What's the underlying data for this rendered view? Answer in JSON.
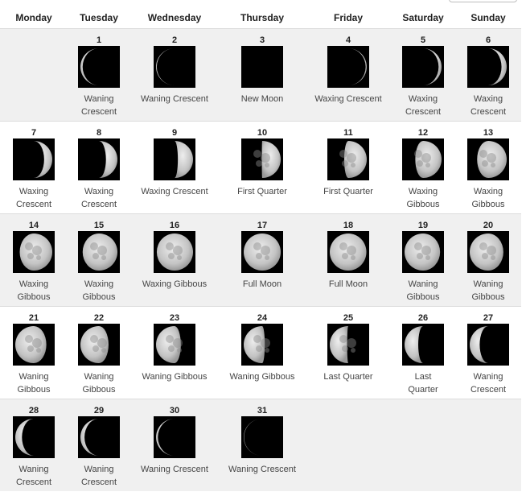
{
  "weekdays": [
    "Monday",
    "Tuesday",
    "Wednesday",
    "Thursday",
    "Friday",
    "Saturday",
    "Sunday"
  ],
  "days": [
    {
      "day": "1",
      "phase": "Waning Crescent",
      "illum": 0.06,
      "waxing": false
    },
    {
      "day": "2",
      "phase": "Waning Crescent",
      "illum": 0.02,
      "waxing": false
    },
    {
      "day": "3",
      "phase": "New Moon",
      "illum": 0.0,
      "waxing": true
    },
    {
      "day": "4",
      "phase": "Waxing Crescent",
      "illum": 0.03,
      "waxing": true
    },
    {
      "day": "5",
      "phase": "Waxing Crescent",
      "illum": 0.08,
      "waxing": true
    },
    {
      "day": "6",
      "phase": "Waxing Crescent",
      "illum": 0.14,
      "waxing": true
    },
    {
      "day": "7",
      "phase": "Waxing Crescent",
      "illum": 0.22,
      "waxing": true
    },
    {
      "day": "8",
      "phase": "Waxing Crescent",
      "illum": 0.31,
      "waxing": true
    },
    {
      "day": "9",
      "phase": "Waxing Crescent",
      "illum": 0.41,
      "waxing": true
    },
    {
      "day": "10",
      "phase": "First Quarter",
      "illum": 0.51,
      "waxing": true
    },
    {
      "day": "11",
      "phase": "First Quarter",
      "illum": 0.61,
      "waxing": true
    },
    {
      "day": "12",
      "phase": "Waxing Gibbous",
      "illum": 0.71,
      "waxing": true
    },
    {
      "day": "13",
      "phase": "Waxing Gibbous",
      "illum": 0.8,
      "waxing": true
    },
    {
      "day": "14",
      "phase": "Waxing Gibbous",
      "illum": 0.88,
      "waxing": true
    },
    {
      "day": "15",
      "phase": "Waxing Gibbous",
      "illum": 0.94,
      "waxing": true
    },
    {
      "day": "16",
      "phase": "Waxing Gibbous",
      "illum": 0.98,
      "waxing": true
    },
    {
      "day": "17",
      "phase": "Full Moon",
      "illum": 1.0,
      "waxing": true
    },
    {
      "day": "18",
      "phase": "Full Moon",
      "illum": 0.99,
      "waxing": false
    },
    {
      "day": "19",
      "phase": "Waning Gibbous",
      "illum": 0.96,
      "waxing": false
    },
    {
      "day": "20",
      "phase": "Waning Gibbous",
      "illum": 0.91,
      "waxing": false
    },
    {
      "day": "21",
      "phase": "Waning Gibbous",
      "illum": 0.84,
      "waxing": false
    },
    {
      "day": "22",
      "phase": "Waning Gibbous",
      "illum": 0.76,
      "waxing": false
    },
    {
      "day": "23",
      "phase": "Waning Gibbous",
      "illum": 0.67,
      "waxing": false
    },
    {
      "day": "24",
      "phase": "Waning Gibbous",
      "illum": 0.57,
      "waxing": false
    },
    {
      "day": "25",
      "phase": "Last Quarter",
      "illum": 0.47,
      "waxing": false
    },
    {
      "day": "26",
      "phase": "Last Quarter",
      "illum": 0.37,
      "waxing": false
    },
    {
      "day": "27",
      "phase": "Waning Crescent",
      "illum": 0.27,
      "waxing": false
    },
    {
      "day": "28",
      "phase": "Waning Crescent",
      "illum": 0.18,
      "waxing": false
    },
    {
      "day": "29",
      "phase": "Waning Crescent",
      "illum": 0.11,
      "waxing": false
    },
    {
      "day": "30",
      "phase": "Waning Crescent",
      "illum": 0.05,
      "waxing": false
    },
    {
      "day": "31",
      "phase": "Waning Crescent",
      "illum": 0.01,
      "waxing": false
    }
  ],
  "colors": {
    "row_alt": "#f0f0f0",
    "row_plain": "#ffffff",
    "moon_bg": "#000000",
    "moon_lit": "#d9d9d9"
  }
}
